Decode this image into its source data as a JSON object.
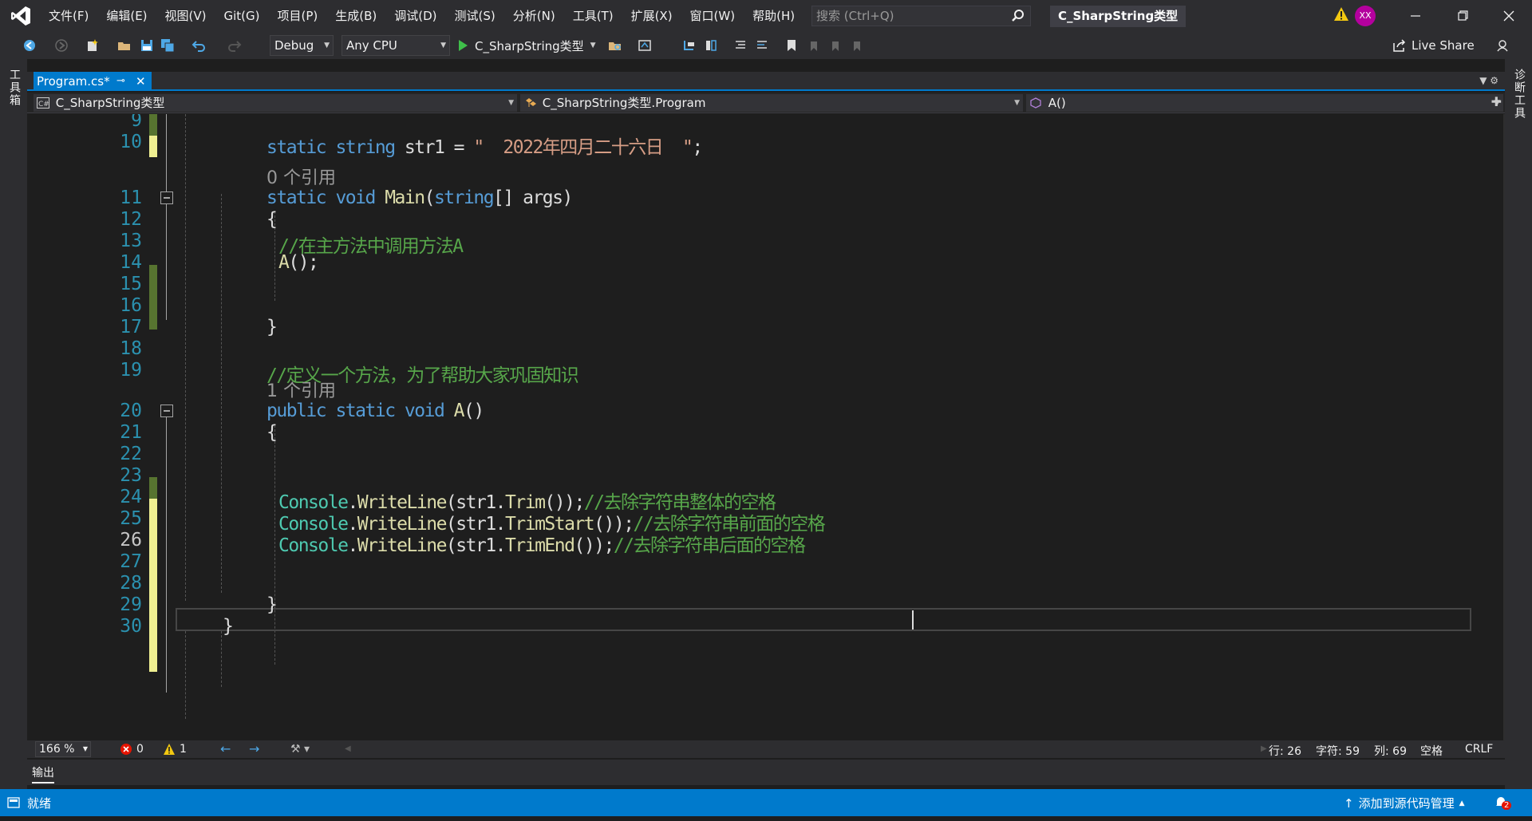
{
  "titlebar": {
    "menu": [
      "文件(F)",
      "编辑(E)",
      "视图(V)",
      "Git(G)",
      "项目(P)",
      "生成(B)",
      "调试(D)",
      "测试(S)",
      "分析(N)",
      "工具(T)",
      "扩展(X)",
      "窗口(W)",
      "帮助(H)"
    ],
    "search_placeholder": "搜索 (Ctrl+Q)",
    "solution_name": "C_SharpString类型",
    "user_initials": "XX"
  },
  "toolbar": {
    "configuration": "Debug",
    "platform": "Any CPU",
    "run_target": "C_SharpString类型",
    "live_share": "Live Share"
  },
  "side": {
    "left_tab": "工具箱",
    "right_tab": "诊断工具"
  },
  "tab": {
    "file_name": "Program.cs*"
  },
  "navbar": {
    "project": "C_SharpString类型",
    "type": "C_SharpString类型.Program",
    "member": "A()"
  },
  "code_lines": [
    {
      "num": "9",
      "text": ""
    },
    {
      "num": "10",
      "text": "static string str1 = \"  2022年四月二十六日  \";"
    },
    {
      "num": "11",
      "text": "static void Main(string[] args)"
    },
    {
      "num": "12",
      "text": "{"
    },
    {
      "num": "13",
      "text": "//在主方法中调用方法A"
    },
    {
      "num": "14",
      "text": "A();"
    },
    {
      "num": "15",
      "text": ""
    },
    {
      "num": "16",
      "text": ""
    },
    {
      "num": "17",
      "text": "}"
    },
    {
      "num": "18",
      "text": ""
    },
    {
      "num": "19",
      "text": "//定义一个方法，为了帮助大家巩固知识"
    },
    {
      "num": "20",
      "text": "public static void A()"
    },
    {
      "num": "21",
      "text": "{"
    },
    {
      "num": "22",
      "text": ""
    },
    {
      "num": "23",
      "text": ""
    },
    {
      "num": "24",
      "text": "Console.WriteLine(str1.Trim());//去除字符串整体的空格"
    },
    {
      "num": "25",
      "text": "Console.WriteLine(str1.TrimStart());//去除字符串前面的空格"
    },
    {
      "num": "26",
      "text": "Console.WriteLine(str1.TrimEnd());//去除字符串后面的空格"
    },
    {
      "num": "27",
      "text": ""
    },
    {
      "num": "28",
      "text": ""
    },
    {
      "num": "29",
      "text": "}"
    },
    {
      "num": "30",
      "text": "}"
    }
  ],
  "code_tokens": {
    "kw_static": "static",
    "kw_string": "string",
    "kw_void": "void",
    "kw_public": "public",
    "str1": "str1",
    "eq": "=",
    "str_literal": "\"  2022年四月二十六日  \"",
    "semi": ";",
    "main": "Main",
    "paren_open": "(",
    "string_arr": "string",
    "brackets": "[]",
    "args": "args",
    "paren_close": ")",
    "a_call": "A",
    "call_parens": "();",
    "a_decl": "A",
    "empty_parens": "()",
    "console": "Console",
    "dot": ".",
    "writeline": "WriteLine",
    "paren": "(",
    "str1_dot": "str1.",
    "trim": "Trim",
    "trim_start": "TrimStart",
    "trim_end": "TrimEnd",
    "close_call": "());",
    "cmt_main": "//在主方法中调用方法A",
    "cmt_define": "//定义一个方法，为了帮助大家巩固知识",
    "cmt_trim": "//去除字符串整体的空格",
    "cmt_trim_start": "//去除字符串前面的空格",
    "cmt_trim_end": "//去除字符串后面的空格",
    "brace_open": "{",
    "brace_close": "}"
  },
  "references": {
    "main_refs": "0 个引用",
    "a_refs": "1 个引用"
  },
  "editor_status": {
    "zoom": "166 %",
    "errors": "0",
    "warnings": "1",
    "line": "行: 26",
    "char": "字符: 59",
    "column": "列: 69",
    "whitespace": "空格",
    "line_ending": "CRLF"
  },
  "output": {
    "label": "输出"
  },
  "statusbar": {
    "state": "就绪",
    "source_control": "添加到源代码管理",
    "notifications": "2"
  },
  "colors": {
    "accent": "#007acc",
    "keyword": "#569cd6",
    "string": "#d69d85",
    "comment": "#57a64a",
    "method": "#dcdcaa",
    "line_number": "#2b91af"
  }
}
